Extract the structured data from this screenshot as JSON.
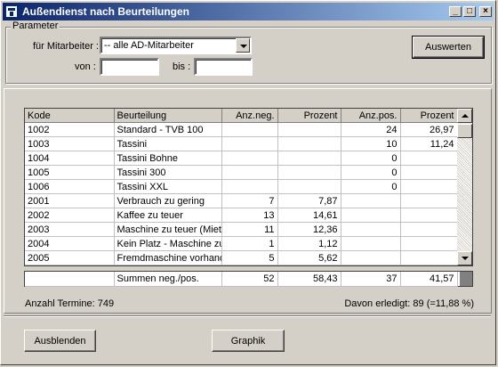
{
  "window": {
    "title": "Außendienst nach Beurteilungen",
    "minimize": "_",
    "maximize": "□",
    "close": "×"
  },
  "parameter": {
    "legend": "Parameter",
    "employee_label": "für Mitarbeiter :",
    "employee_value": "-- alle AD-Mitarbeiter",
    "from_label": "von :",
    "from_value": "",
    "to_label": "bis :",
    "to_value": "",
    "evaluate_label": "Auswerten"
  },
  "grid": {
    "columns": [
      "Kode",
      "Beurteilung",
      "Anz.neg.",
      "Prozent",
      "Anz.pos.",
      "Prozent"
    ],
    "rows": [
      [
        "1002",
        "Standard - TVB 100",
        "",
        "",
        "24",
        "26,97"
      ],
      [
        "1003",
        "Tassini",
        "",
        "",
        "10",
        "11,24"
      ],
      [
        "1004",
        "Tassini Bohne",
        "",
        "",
        "0",
        ""
      ],
      [
        "1005",
        "Tassini 300",
        "",
        "",
        "0",
        ""
      ],
      [
        "1006",
        "Tassini XXL",
        "",
        "",
        "0",
        ""
      ],
      [
        "2001",
        "Verbrauch zu gering",
        "7",
        "7,87",
        "",
        ""
      ],
      [
        "2002",
        "Kaffee zu teuer",
        "13",
        "14,61",
        "",
        ""
      ],
      [
        "2003",
        "Maschine zu teuer (Miete",
        "11",
        "12,36",
        "",
        ""
      ],
      [
        "2004",
        "Kein Platz - Maschine zu",
        "1",
        "1,12",
        "",
        ""
      ],
      [
        "2005",
        "Fremdmaschine vorhand",
        "5",
        "5,62",
        "",
        ""
      ]
    ]
  },
  "summary": {
    "label": "Summen neg./pos.",
    "neg_count": "52",
    "neg_percent": "58,43",
    "pos_count": "37",
    "pos_percent": "41,57"
  },
  "status": {
    "appointments": "Anzahl Termine: 749",
    "done": "Davon erledigt: 89 (=11,88 %)"
  },
  "footer": {
    "hide_label": "Ausblenden",
    "graph_label": "Graphik"
  }
}
